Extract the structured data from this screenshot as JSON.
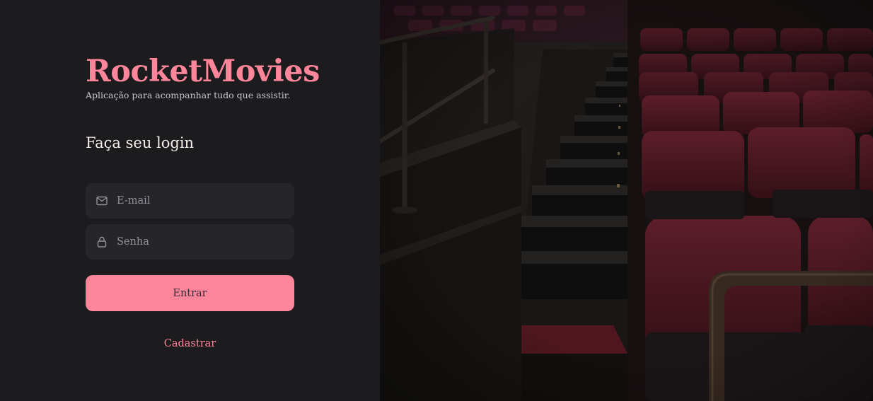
{
  "brand": {
    "title": "RocketMovies",
    "subtitle": "Aplicação para acompanhar tudo que assistir."
  },
  "login": {
    "heading": "Faça seu login",
    "email_placeholder": "E-mail",
    "password_placeholder": "Senha",
    "submit_label": "Entrar",
    "register_label": "Cadastrar"
  },
  "icons": {
    "email": "mail-icon",
    "password": "lock-icon"
  },
  "colors": {
    "background": "#1c1b1e",
    "accent": "#ff859b",
    "input_background": "#262529",
    "text_primary": "#f4ede8",
    "placeholder": "#948f99"
  }
}
